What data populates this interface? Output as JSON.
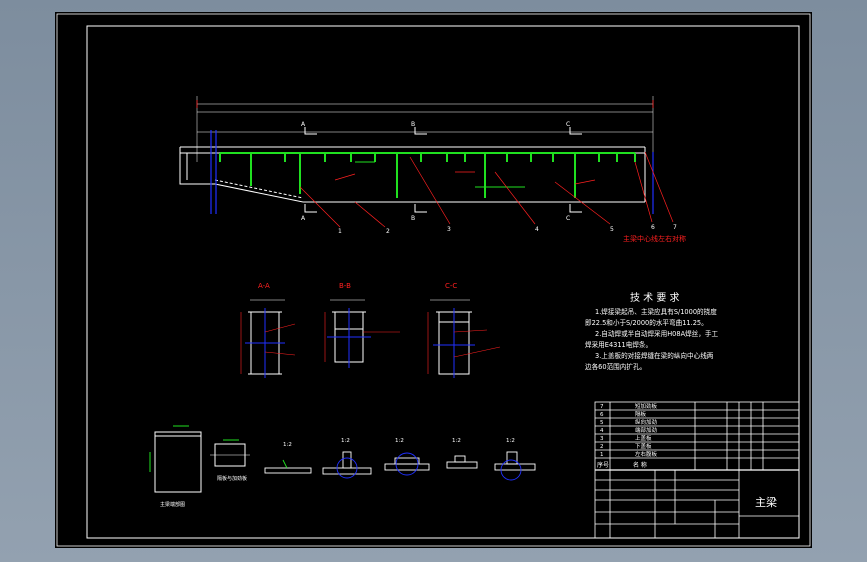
{
  "drawing": {
    "part_title": "主梁",
    "colors": {
      "background": "#000000",
      "line": "#ffffff",
      "accent_red": "#ff2020",
      "accent_green": "#20e020",
      "accent_blue": "#2030ff",
      "viewport": "#8796a6"
    },
    "sections": [
      "A-A",
      "B-B",
      "C-C"
    ],
    "main_note": "主梁中心线左右对称",
    "tech_req": {
      "title": "技 术 要 求",
      "lines": [
        "1.焊接梁起吊、主梁应具有S/1000的挠度",
        "即22.5和小于S/2000的水平弯曲11.25。",
        "2.自动焊或半自动焊采用H08A焊丝，手工",
        "焊采用E4311电焊条。",
        "3.上盖板的对接焊缝在梁的纵向中心线两",
        "边各60范围内扩孔。"
      ]
    },
    "part_numbers": [
      "1",
      "2",
      "3",
      "4",
      "5",
      "6",
      "7"
    ],
    "bom_rows": [
      [
        "7",
        "短加劲板"
      ],
      [
        "6",
        "隔板"
      ],
      [
        "5",
        "纵向加劲"
      ],
      [
        "4",
        "端部加劲"
      ],
      [
        "3",
        "上盖板"
      ],
      [
        "2",
        "下盖板"
      ],
      [
        "1",
        "左右腹板"
      ]
    ],
    "bom_header": [
      "序号",
      "名 称"
    ],
    "side_labels": [
      "主梁端部图",
      "隔板与加劲板"
    ],
    "detail_labels": [
      "1:2",
      "1:2",
      "1:2",
      "1:2",
      "1:2"
    ]
  }
}
